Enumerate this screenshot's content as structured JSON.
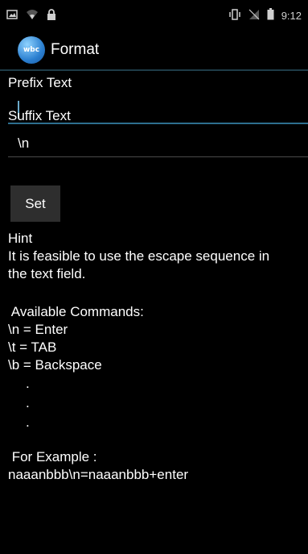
{
  "status_bar": {
    "time": "9:12",
    "icons": [
      "gallery-icon",
      "wifi-icon",
      "lock-icon",
      "vibrate-icon",
      "no-signal-icon",
      "battery-icon"
    ]
  },
  "action_bar": {
    "title": "Format",
    "logo_text": "wbc"
  },
  "prefix": {
    "label": "Prefix Text",
    "value": ""
  },
  "suffix": {
    "label": "Suffix Text",
    "value": "\\n"
  },
  "set_button": {
    "label": "Set"
  },
  "hint": {
    "title": "Hint",
    "line1": "It is feasible to use the escape sequence in",
    "line2": "the text field."
  },
  "commands": {
    "header": " Available Commands:",
    "items": [
      "\\n = Enter",
      "\\t = TAB",
      "\\b = Backspace"
    ],
    "dots": [
      ".",
      ".",
      "."
    ]
  },
  "example": {
    "header": " For Example :",
    "value": "naaanbbb\\n=naaanbbb+enter"
  }
}
